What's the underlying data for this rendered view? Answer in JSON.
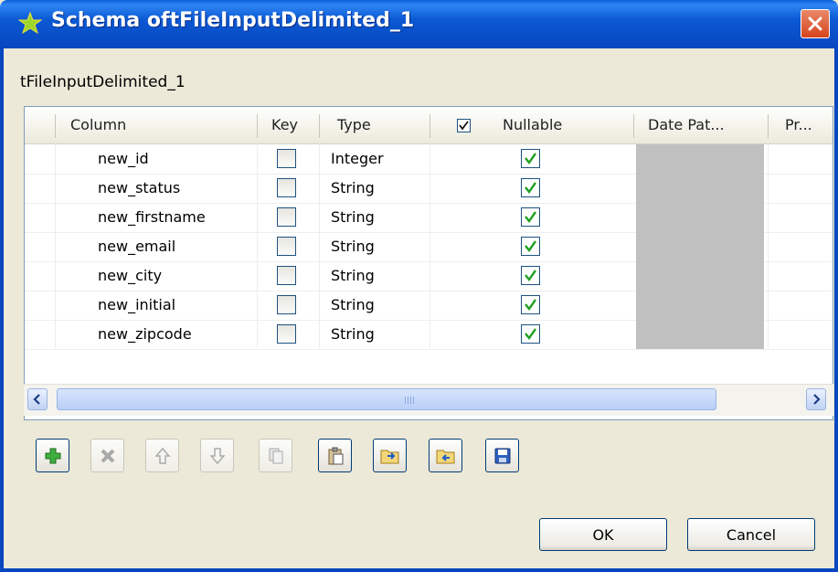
{
  "window": {
    "title": "Schema oftFileInputDelimited_1"
  },
  "component_label": "tFileInputDelimited_1",
  "table": {
    "headers": [
      "Column",
      "Key",
      "Type",
      "Nullable",
      "Date Pat...",
      "Pr..."
    ],
    "header_nullable_checked": true,
    "rows": [
      {
        "column": "new_id",
        "key": false,
        "type": "Integer",
        "nullable": true
      },
      {
        "column": "new_status",
        "key": false,
        "type": "String",
        "nullable": true
      },
      {
        "column": "new_firstname",
        "key": false,
        "type": "String",
        "nullable": true
      },
      {
        "column": "new_email",
        "key": false,
        "type": "String",
        "nullable": true
      },
      {
        "column": "new_city",
        "key": false,
        "type": "String",
        "nullable": true
      },
      {
        "column": "new_initial",
        "key": false,
        "type": "String",
        "nullable": true
      },
      {
        "column": "new_zipcode",
        "key": false,
        "type": "String",
        "nullable": true
      }
    ]
  },
  "toolbar": [
    {
      "name": "add-button",
      "icon": "plus-icon",
      "enabled": true
    },
    {
      "name": "remove-button",
      "icon": "x-icon",
      "enabled": false
    },
    {
      "name": "move-up-button",
      "icon": "arrow-up-icon",
      "enabled": false
    },
    {
      "name": "move-down-button",
      "icon": "arrow-down-icon",
      "enabled": false
    },
    {
      "name": "copy-button",
      "icon": "copy-icon",
      "enabled": false
    },
    {
      "name": "paste-button",
      "icon": "paste-icon",
      "enabled": true
    },
    {
      "name": "import-button",
      "icon": "import-folder-icon",
      "enabled": true
    },
    {
      "name": "export-button",
      "icon": "export-folder-icon",
      "enabled": true
    },
    {
      "name": "save-button",
      "icon": "floppy-disk-icon",
      "enabled": true
    }
  ],
  "buttons": {
    "ok": "OK",
    "cancel": "Cancel"
  },
  "colors": {
    "titlebar": "#0b59d3",
    "dialog_bg": "#ece9d8",
    "check": "#21a121",
    "plus": "#2a9a2a"
  }
}
